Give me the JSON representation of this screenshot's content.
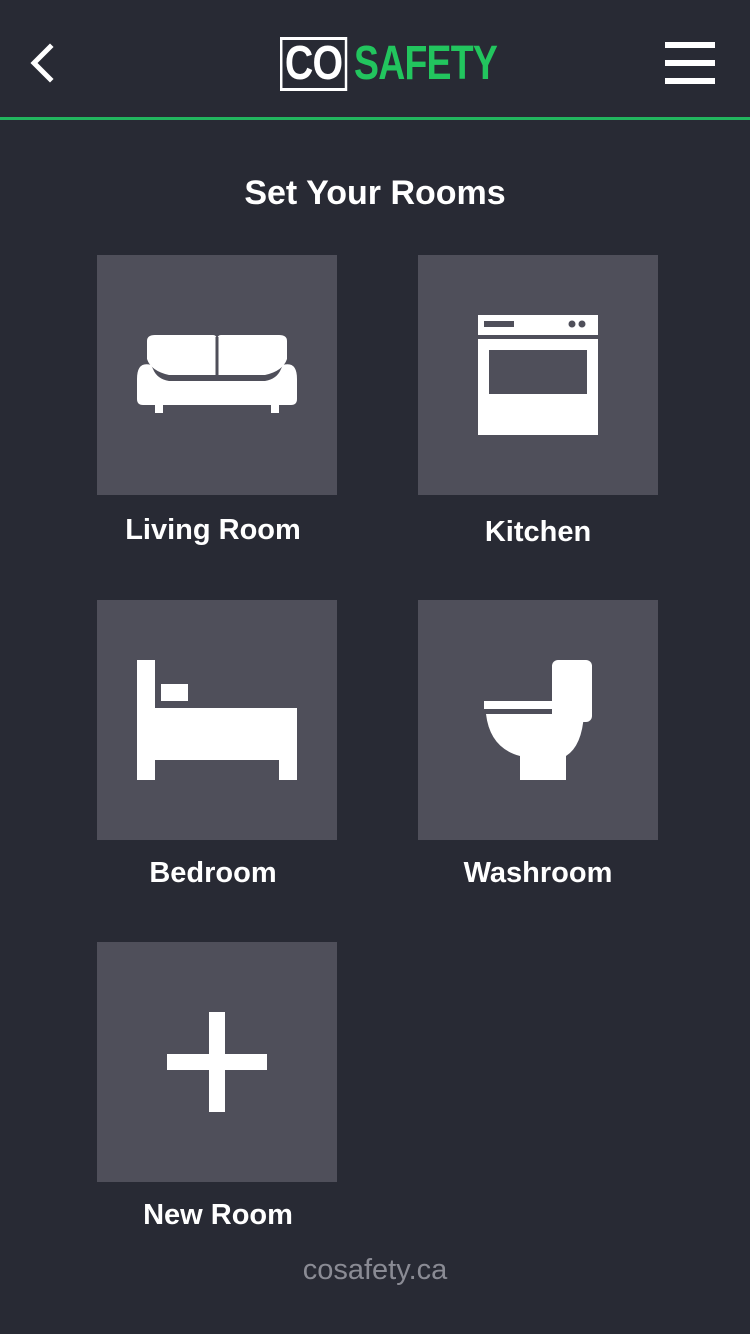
{
  "header": {
    "back_icon": "chevron-left-icon",
    "menu_icon": "hamburger-menu-icon",
    "logo": {
      "prefix": "CO",
      "suffix": "SAFETY"
    },
    "accent_color": "#22c55e"
  },
  "page": {
    "title": "Set Your Rooms"
  },
  "rooms": [
    {
      "label": "Living Room",
      "icon": "sofa-icon"
    },
    {
      "label": "Kitchen",
      "icon": "oven-icon"
    },
    {
      "label": "Bedroom",
      "icon": "bed-icon"
    },
    {
      "label": "Washroom",
      "icon": "toilet-icon"
    },
    {
      "label": "New Room",
      "icon": "plus-icon"
    }
  ],
  "footer": {
    "link": "cosafety.ca"
  },
  "colors": {
    "background": "#282a34",
    "tile": "#4f4f5a",
    "divider": "#22b55e",
    "footer_text": "#8a8b94"
  }
}
